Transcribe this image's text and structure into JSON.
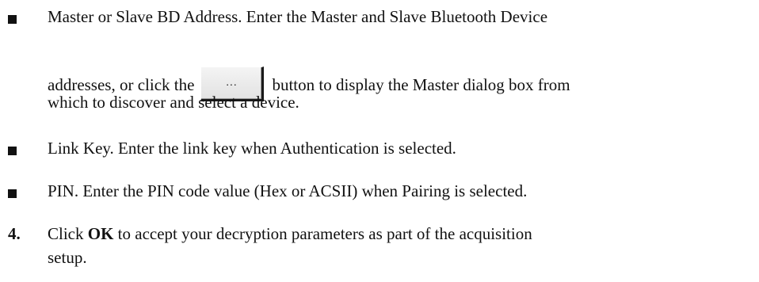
{
  "items": [
    {
      "marker": "bullet",
      "line1": "Master or Slave BD Address. Enter the Master and Slave Bluetooth Device",
      "line2_before": "addresses, or click the",
      "button_label": "...",
      "line2_after": "button to display the Master dialog box from",
      "line3": "which to discover and select a device."
    },
    {
      "marker": "bullet",
      "text": "Link Key. Enter the link key when Authentication is selected."
    },
    {
      "marker": "bullet",
      "text": "PIN. Enter the PIN code value (Hex or ACSII) when Pairing is selected."
    },
    {
      "marker": "4.",
      "before": "Click",
      "bold": "OK",
      "after": "to accept your decryption parameters as part of the acquisition",
      "line2": "setup."
    }
  ]
}
